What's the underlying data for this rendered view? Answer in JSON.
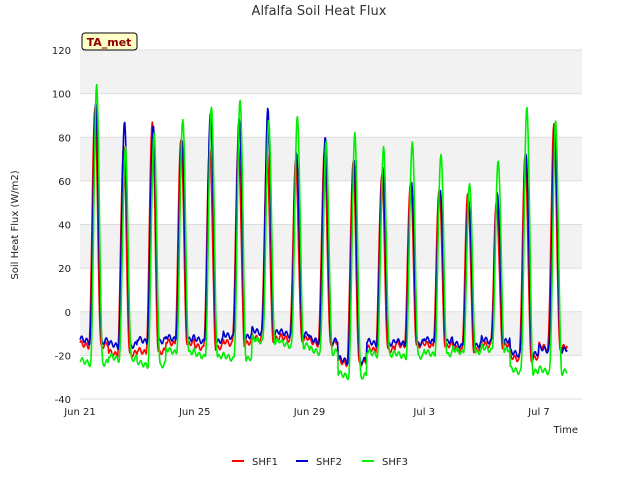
{
  "chart_data": {
    "type": "line",
    "title": "Alfalfa Soil Heat Flux",
    "xlabel": "Time",
    "ylabel": "Soil Heat Flux (W/m2)",
    "badge": "TA_met",
    "xlim": [
      0,
      17.5
    ],
    "ylim": [
      -40,
      120
    ],
    "yticks": [
      -40,
      -20,
      0,
      20,
      40,
      60,
      80,
      100,
      120
    ],
    "xticks": [
      {
        "value": 0,
        "label": "Jun 21"
      },
      {
        "value": 4,
        "label": "Jun 25"
      },
      {
        "value": 8,
        "label": "Jun 29"
      },
      {
        "value": 12,
        "label": "Jul 3"
      },
      {
        "value": 16,
        "label": "Jul 7"
      }
    ],
    "grid": true,
    "legend_position": "bottom",
    "days": [
      0,
      1,
      2,
      3,
      4,
      5,
      6,
      7,
      8,
      9,
      10,
      11,
      12,
      13,
      14,
      15,
      16
    ],
    "series": [
      {
        "name": "SHF1",
        "color": "#ff0000",
        "peaks": [
          93,
          76,
          88,
          80,
          76,
          76,
          73,
          68,
          73,
          68,
          63,
          60,
          57,
          55,
          50,
          71,
          85
        ],
        "troughs": [
          -16,
          -20,
          -19,
          -15,
          -17,
          -15,
          -13,
          -13,
          -15,
          -24,
          -18,
          -16,
          -16,
          -18,
          -16,
          -22,
          -17
        ]
      },
      {
        "name": "SHF2",
        "color": "#0000cc",
        "peaks": [
          95,
          87,
          86,
          80,
          92,
          89,
          93,
          72,
          79,
          69,
          66,
          60,
          57,
          52,
          55,
          72,
          83
        ],
        "troughs": [
          -14,
          -16,
          -14,
          -13,
          -14,
          -12,
          -10,
          -11,
          -14,
          -23,
          -15,
          -15,
          -14,
          -16,
          -14,
          -20,
          -18
        ]
      },
      {
        "name": "SHF3",
        "color": "#00ee00",
        "peaks": [
          103,
          75,
          82,
          89,
          95,
          98,
          88,
          89,
          77,
          81,
          75,
          78,
          73,
          60,
          70,
          94,
          87
        ],
        "troughs": [
          -24,
          -22,
          -25,
          -19,
          -21,
          -22,
          -14,
          -16,
          -19,
          -30,
          -20,
          -21,
          -20,
          -19,
          -18,
          -28,
          -28
        ]
      }
    ]
  }
}
